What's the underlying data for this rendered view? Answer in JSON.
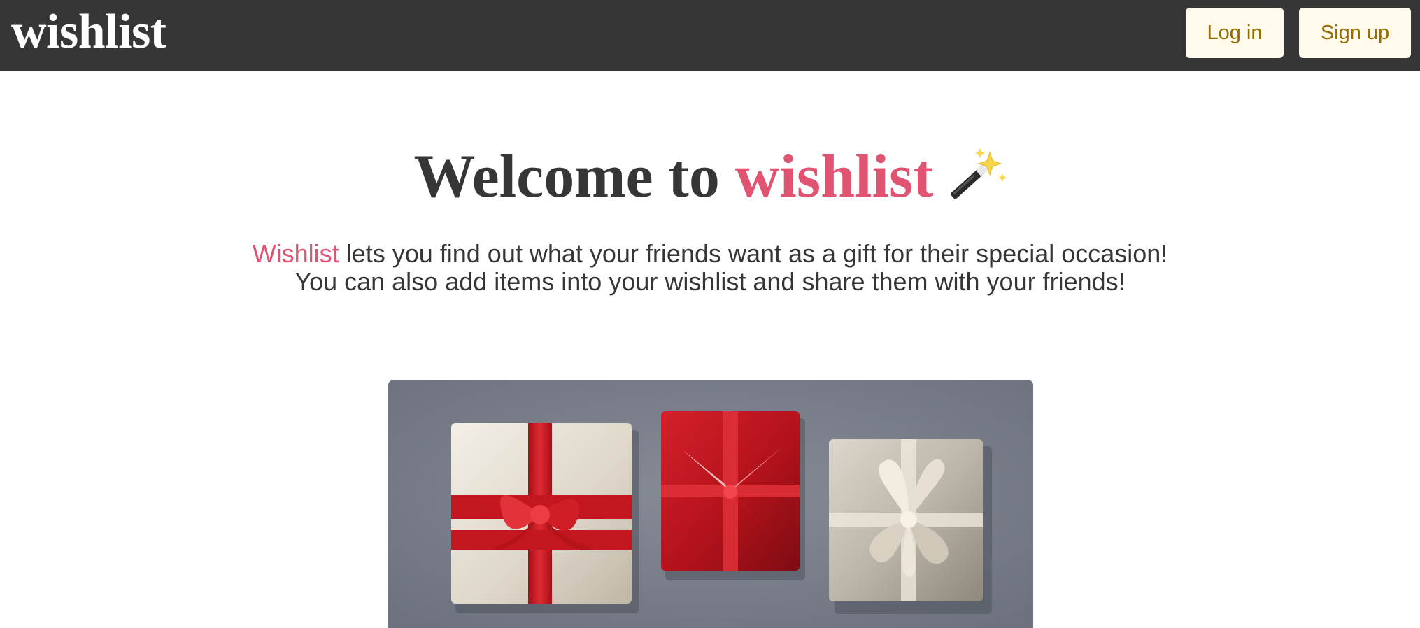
{
  "navbar": {
    "logo": "wishlist",
    "login_label": "Log in",
    "signup_label": "Sign up"
  },
  "hero": {
    "title_prefix": "Welcome to ",
    "title_accent": "wishlist",
    "subtitle_accent": "Wishlist",
    "subtitle_line1_rest": " lets you find out what your friends want as a gift for their special occasion!",
    "subtitle_line2": "You can also add items into your wishlist and share them with your friends!"
  },
  "icons": {
    "title_icon": "magic-wand-icon"
  },
  "colors": {
    "navbar_bg": "#363636",
    "accent": "#e05472",
    "button_bg": "#fffaeb",
    "button_text": "#946c00",
    "text": "#363636"
  }
}
